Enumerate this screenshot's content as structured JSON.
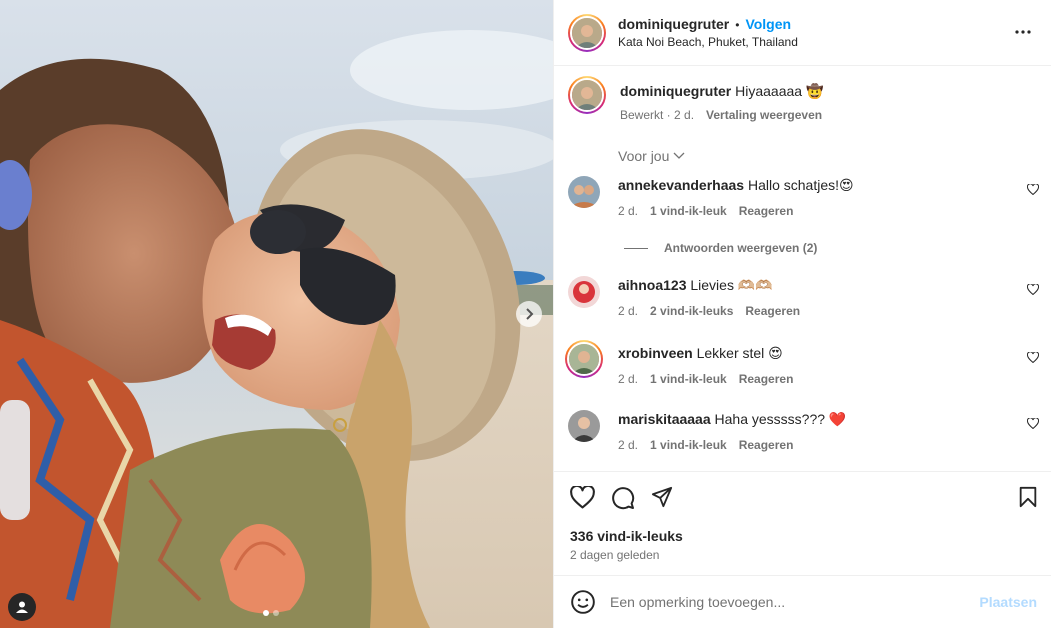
{
  "post": {
    "username": "dominiquegruter",
    "separator": "•",
    "follow_label": "Volgen",
    "location": "Kata Noi Beach, Phuket, Thailand"
  },
  "caption": {
    "username": "dominiquegruter",
    "text": "Hiyaaaaaa 🤠",
    "edited": "Bewerkt · 2 d.",
    "translate": "Vertaling weergeven"
  },
  "filter": {
    "label": "Voor jou"
  },
  "comments": [
    {
      "username": "annekevanderhaas",
      "text": "Hallo schatjes!😍",
      "age": "2 d.",
      "likes": "1 vind-ik-leuk",
      "reply": "Reageren"
    },
    {
      "username": "aihnoa123",
      "text": "Lievies 🫶🏼🫶🏼",
      "age": "2 d.",
      "likes": "2 vind-ik-leuks",
      "reply": "Reageren"
    },
    {
      "username": "xrobinveen",
      "text": "Lekker stel 😍",
      "age": "2 d.",
      "likes": "1 vind-ik-leuk",
      "reply": "Reageren"
    },
    {
      "username": "mariskitaaaaa",
      "text": "Haha yesssss??? ❤️",
      "age": "2 d.",
      "likes": "1 vind-ik-leuk",
      "reply": "Reageren"
    }
  ],
  "replies_toggle": "Antwoorden weergeven (2)",
  "stats": {
    "likes": "336 vind-ik-leuks",
    "posted": "2 dagen geleden"
  },
  "composer": {
    "placeholder": "Een opmerking toevoegen...",
    "post_label": "Plaatsen"
  },
  "carousel": {
    "total": 2,
    "current": 1
  },
  "colors": {
    "accent": "#0095f6",
    "muted": "#737373",
    "post_disabled": "#b3dbff"
  },
  "icons": [
    "heart-icon",
    "comment-icon",
    "share-icon",
    "bookmark-icon",
    "more-icon",
    "emoji-icon",
    "chevron-right-icon",
    "user-tag-icon",
    "chevron-down-icon"
  ]
}
